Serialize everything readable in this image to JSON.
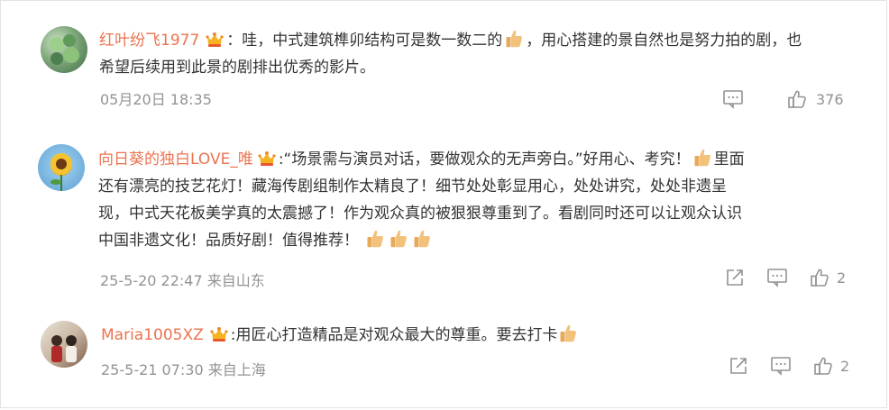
{
  "comments": [
    {
      "username": "红叶纷飞1977",
      "lines": [
        "：哇，中式建筑榫卯结构可是数一数二的",
        "，用心搭建的景自然也是努力拍的剧，也",
        "希望后续用到此景的剧排出优秀的影片。"
      ],
      "meta": "05月20日 18:35",
      "likes": "376"
    },
    {
      "username": "向日葵的独白LOVE_唯",
      "lines": [
        ":“场景需与演员对话，要做观众的无声旁白。”好用心、考究！",
        "里面",
        "还有漂亮的技艺花灯！藏海传剧组制作太精良了！细节处处彰显用心，处处讲究，处处非遗呈",
        "现，中式天花板美学真的太震撼了！作为观众真的被狠狠尊重到了。看剧同时还可以让观众认识",
        "中国非遗文化！品质好剧！值得推荐！"
      ],
      "meta": "25-5-20 22:47 来自山东",
      "likes": "2"
    },
    {
      "username": "Maria1005XZ",
      "lines": [
        ":用匠心打造精品是对观众最大的尊重。要去打卡"
      ],
      "meta": "25-5-21 07:30 来自上海",
      "likes": "2"
    }
  ],
  "icons": {
    "badge": "crown-badge-icon",
    "thumb": "thumbs-up-emoji",
    "comment": "comment-icon",
    "share": "share-icon",
    "like": "like-icon"
  },
  "colors": {
    "username": "#eb7350",
    "meta": "#939393",
    "text": "#333333"
  }
}
